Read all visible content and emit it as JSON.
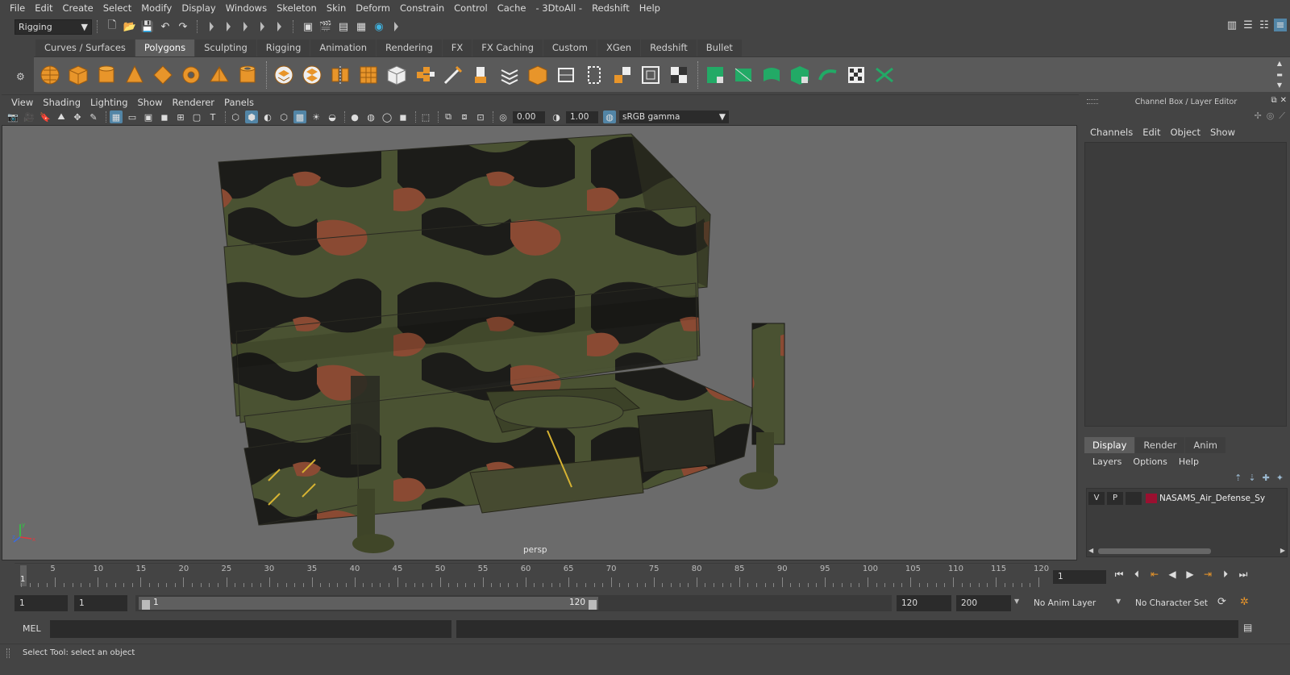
{
  "menubar": {
    "items": [
      "File",
      "Edit",
      "Create",
      "Select",
      "Modify",
      "Display",
      "Windows",
      "Skeleton",
      "Skin",
      "Deform",
      "Constrain",
      "Control",
      "Cache",
      "- 3DtoAll -",
      "Redshift",
      "Help"
    ]
  },
  "statusline": {
    "menu_set": "Rigging"
  },
  "shelf": {
    "tabs": [
      "Curves / Surfaces",
      "Polygons",
      "Sculpting",
      "Rigging",
      "Animation",
      "Rendering",
      "FX",
      "FX Caching",
      "Custom",
      "XGen",
      "Redshift",
      "Bullet"
    ],
    "active_tab": "Polygons"
  },
  "viewport": {
    "menu": [
      "View",
      "Shading",
      "Lighting",
      "Show",
      "Renderer",
      "Panels"
    ],
    "exposure": "0.00",
    "gamma": "1.00",
    "color_management": "sRGB gamma",
    "camera_label": "persp"
  },
  "channel_box": {
    "title": "Channel Box / Layer Editor",
    "menu": [
      "Channels",
      "Edit",
      "Object",
      "Show"
    ]
  },
  "layer_editor": {
    "tabs": [
      "Display",
      "Render",
      "Anim"
    ],
    "active_tab": "Display",
    "menu": [
      "Layers",
      "Options",
      "Help"
    ],
    "layers": [
      {
        "visible": "V",
        "playback": "P",
        "color": "#9a1030",
        "name": "NASAMS_Air_Defense_Sy"
      }
    ]
  },
  "timeslider": {
    "ticks": [
      "5",
      "10",
      "15",
      "20",
      "25",
      "30",
      "35",
      "40",
      "45",
      "50",
      "55",
      "60",
      "65",
      "70",
      "75",
      "80",
      "85",
      "90",
      "95",
      "100",
      "105",
      "110",
      "115",
      "120"
    ],
    "current_marker": "1",
    "current_frame": "1"
  },
  "range": {
    "start": "1",
    "playback_start": "1",
    "slider_start": "1",
    "slider_end": "120",
    "playback_end": "120",
    "end": "200",
    "anim_layer": "No Anim Layer",
    "character_set": "No Character Set"
  },
  "command_line": {
    "label": "MEL"
  },
  "help_line": {
    "text": "Select Tool: select an object"
  }
}
